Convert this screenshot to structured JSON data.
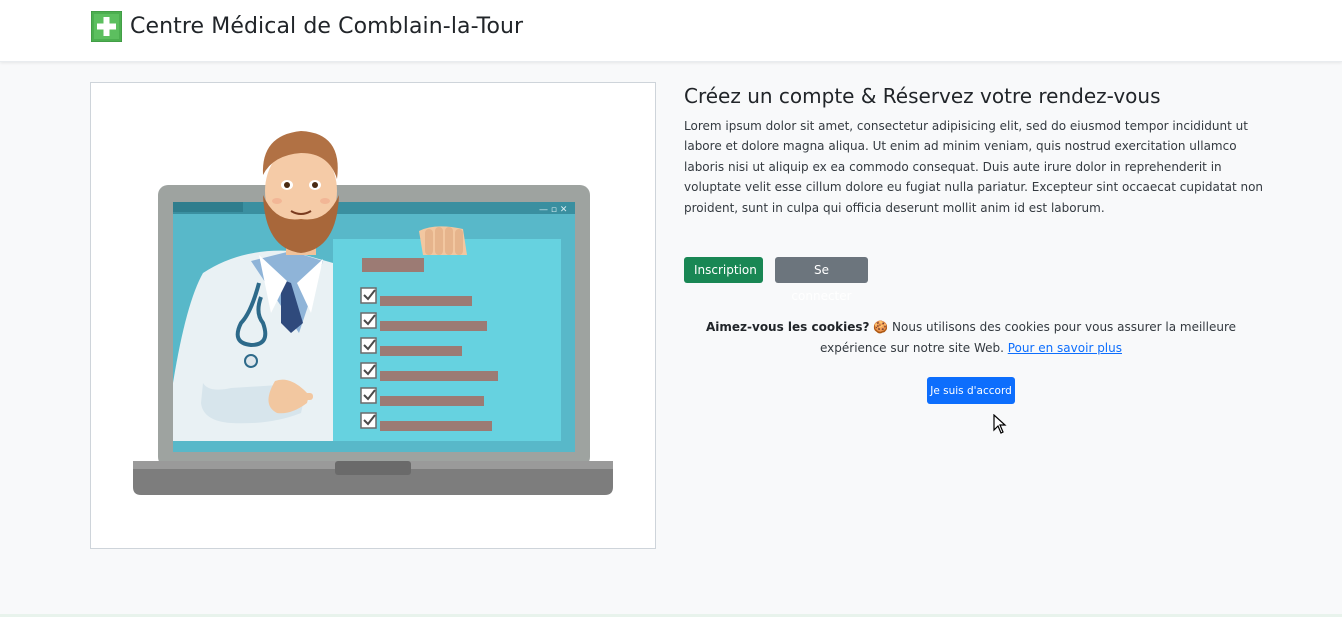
{
  "brand": {
    "title": "Centre Médical de Comblain-la-Tour",
    "logo_icon": "green-cross-icon",
    "logo_color": "#4caf50"
  },
  "hero": {
    "illustration": "doctor-laptop-checklist-illustration"
  },
  "main": {
    "heading": "Créez un compte & Réservez votre rendez-vous",
    "body": "Lorem ipsum dolor sit amet, consectetur adipisicing elit, sed do eiusmod tempor incididunt ut labore et dolore magna aliqua. Ut enim ad minim veniam, quis nostrud exercitation ullamco laboris nisi ut aliquip ex ea commodo consequat. Duis aute irure dolor in reprehenderit in voluptate velit esse cillum dolore eu fugiat nulla pariatur. Excepteur sint occaecat cupidatat non proident, sunt in culpa qui officia deserunt mollit anim id est laborum."
  },
  "actions": {
    "register_label": "Inscription",
    "login_label": "Se connecter"
  },
  "cookie_banner": {
    "title": "Aimez-vous les cookies?",
    "emoji": "🍪",
    "text": "Nous utilisons des cookies pour vous assurer la meilleure expérience sur notre site Web.",
    "link_label": "Pour en savoir plus",
    "accept_label": "Je suis d'accord"
  },
  "colors": {
    "success": "#198754",
    "secondary": "#6c757d",
    "primary": "#0d6efd",
    "page_bg": "#f8f9fa"
  }
}
